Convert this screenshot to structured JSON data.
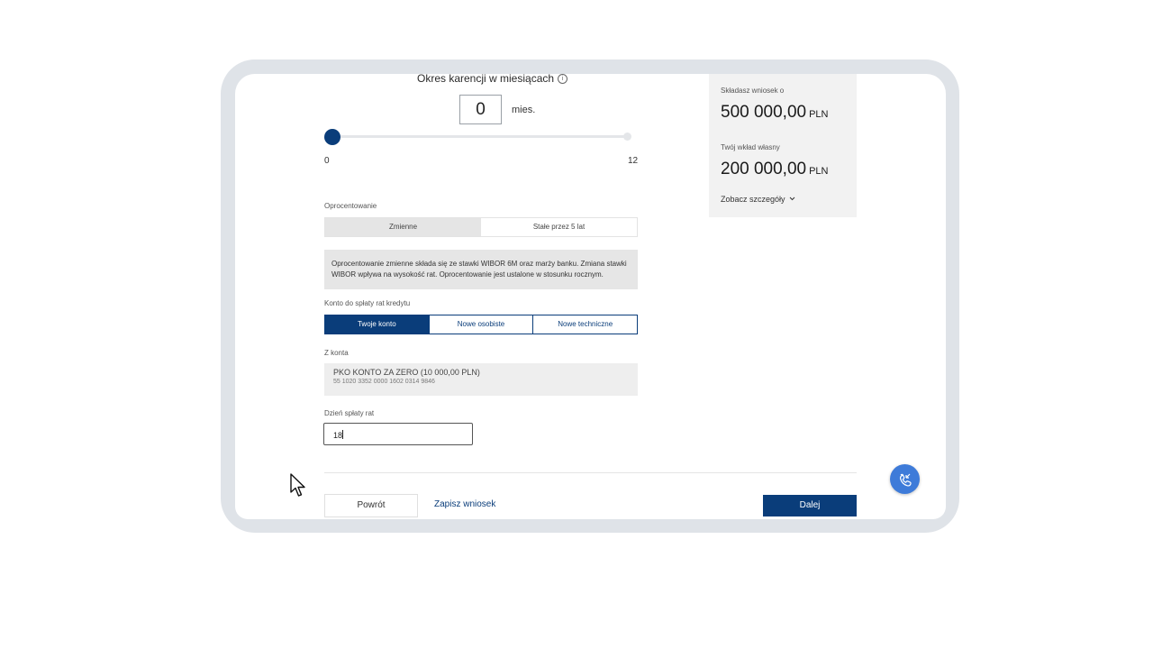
{
  "karencja": {
    "label": "Okres karencji w miesiącach",
    "info_icon": "i",
    "value": "0",
    "unit": "mies.",
    "slider_min": "0",
    "slider_max": "12",
    "slider_fraction": 0
  },
  "oprocentowanie": {
    "label": "Oprocentowanie",
    "options": [
      "Zmienne",
      "Stałe przez 5 lat"
    ],
    "selected": "Zmienne",
    "info_text": "Oprocentowanie zmienne składa się ze stawki WIBOR 6M oraz marży banku. Zmiana stawki WIBOR wpływa na wysokość rat. Oprocentowanie jest ustalone w stosunku rocznym."
  },
  "konto": {
    "label": "Konto do spłaty rat kredytu",
    "options": [
      "Twoje konto",
      "Nowe osobiste",
      "Nowe techniczne"
    ],
    "selected": "Twoje konto"
  },
  "z_konta": {
    "label": "Z konta",
    "account_name": "PKO KONTO ZA ZERO (10 000,00 PLN)",
    "account_number": "55 1020 3352 0000 1602 0314 9846"
  },
  "dzien": {
    "label": "Dzień spłaty rat",
    "value": "18"
  },
  "actions": {
    "back": "Powrót",
    "save": "Zapisz wniosek",
    "next": "Dalej"
  },
  "summary": {
    "request_label": "Składasz wniosek o",
    "request_value": "500 000,00",
    "request_currency": "PLN",
    "own_label": "Twój wkład własny",
    "own_value": "200 000,00",
    "own_currency": "PLN",
    "details_link": "Zobacz szczegóły",
    "details_icon": "chevron-down-icon"
  },
  "fab_icon": "phone-callback-icon",
  "colors": {
    "primary": "#0a3d7a",
    "fab": "#3e7bd9",
    "frame": "#dfe3e8"
  }
}
